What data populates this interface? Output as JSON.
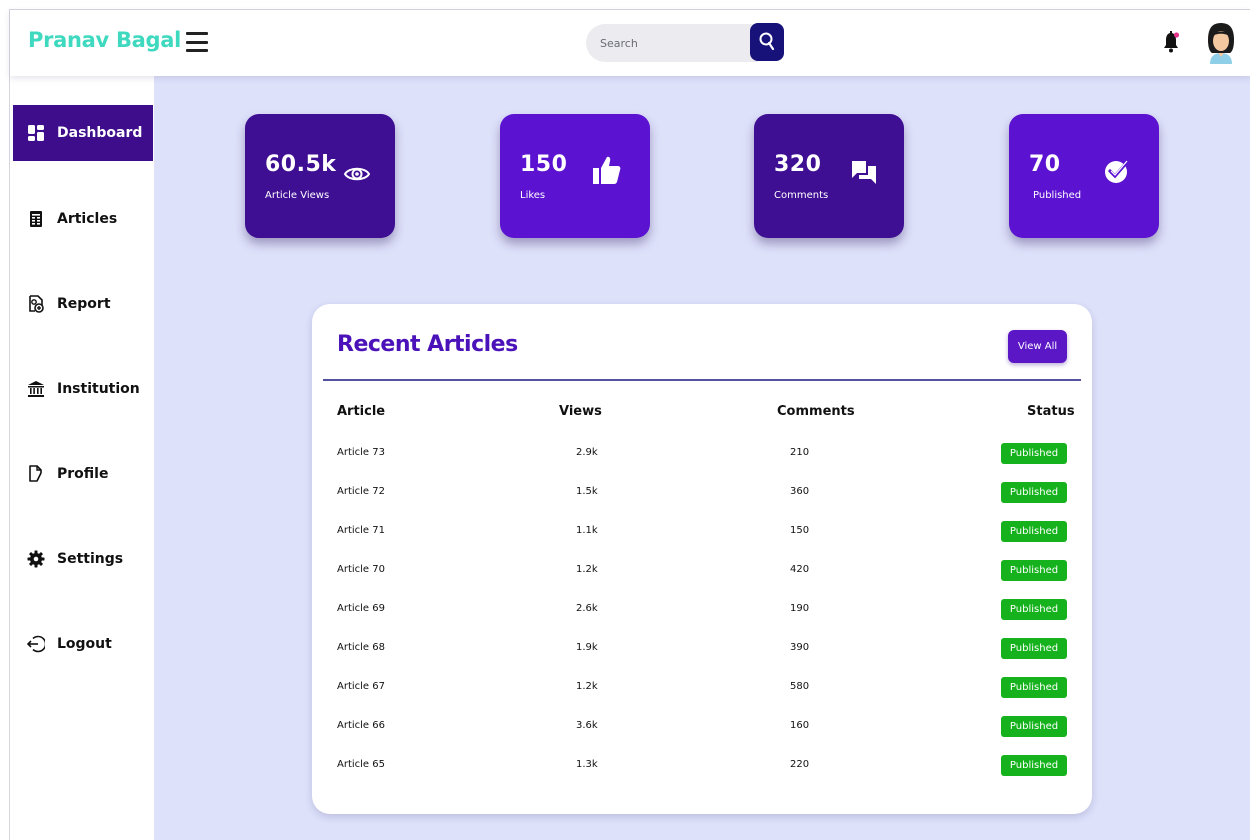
{
  "brand": {
    "name": "Pranav Bagal",
    "color": "#3fd9c0"
  },
  "header": {
    "menu_icon": "hamburger-icon",
    "search": {
      "placeholder": "Search",
      "value": "",
      "button_icon": "search-icon"
    },
    "notification_icon": "bell-icon",
    "avatar_icon": "user-avatar"
  },
  "sidebar": {
    "items": [
      {
        "label": "Dashboard",
        "icon": "dashboard-icon",
        "active": true
      },
      {
        "label": "Articles",
        "icon": "articles-icon",
        "active": false
      },
      {
        "label": "Report",
        "icon": "report-icon",
        "active": false
      },
      {
        "label": "Institution",
        "icon": "institution-icon",
        "active": false
      },
      {
        "label": "Profile",
        "icon": "profile-icon",
        "active": false
      },
      {
        "label": "Settings",
        "icon": "gear-icon",
        "active": false
      },
      {
        "label": "Logout",
        "icon": "logout-icon",
        "active": false
      }
    ]
  },
  "stats": [
    {
      "value": "60.5k",
      "label": "Article Views",
      "icon": "eye-icon",
      "color": "#3f0f93"
    },
    {
      "value": "150",
      "label": "Likes",
      "icon": "thumbs-up-icon",
      "color": "#5b12d1"
    },
    {
      "value": "320",
      "label": "Comments",
      "icon": "comments-icon",
      "color": "#3f0f93"
    },
    {
      "value": "70",
      "label": "Published",
      "icon": "check-badge-icon",
      "color": "#5b12d1"
    }
  ],
  "recent": {
    "title": "Recent Articles",
    "view_all_label": "View All",
    "columns": [
      "Article",
      "Views",
      "Comments",
      "Status"
    ],
    "rows": [
      {
        "article": "Article 73",
        "views": "2.9k",
        "comments": "210",
        "status": "Published"
      },
      {
        "article": "Article 72",
        "views": "1.5k",
        "comments": "360",
        "status": "Published"
      },
      {
        "article": "Article 71",
        "views": "1.1k",
        "comments": "150",
        "status": "Published"
      },
      {
        "article": "Article 70",
        "views": "1.2k",
        "comments": "420",
        "status": "Published"
      },
      {
        "article": "Article 69",
        "views": "2.6k",
        "comments": "190",
        "status": "Published"
      },
      {
        "article": "Article 68",
        "views": "1.9k",
        "comments": "390",
        "status": "Published"
      },
      {
        "article": "Article 67",
        "views": "1.2k",
        "comments": "580",
        "status": "Published"
      },
      {
        "article": "Article 66",
        "views": "3.6k",
        "comments": "160",
        "status": "Published"
      },
      {
        "article": "Article 65",
        "views": "1.3k",
        "comments": "220",
        "status": "Published"
      }
    ],
    "status_color": "#16b21d"
  },
  "colors": {
    "background": "#dee1fa",
    "active_nav": "#3d0d8c",
    "accent": "#4a12b8"
  }
}
